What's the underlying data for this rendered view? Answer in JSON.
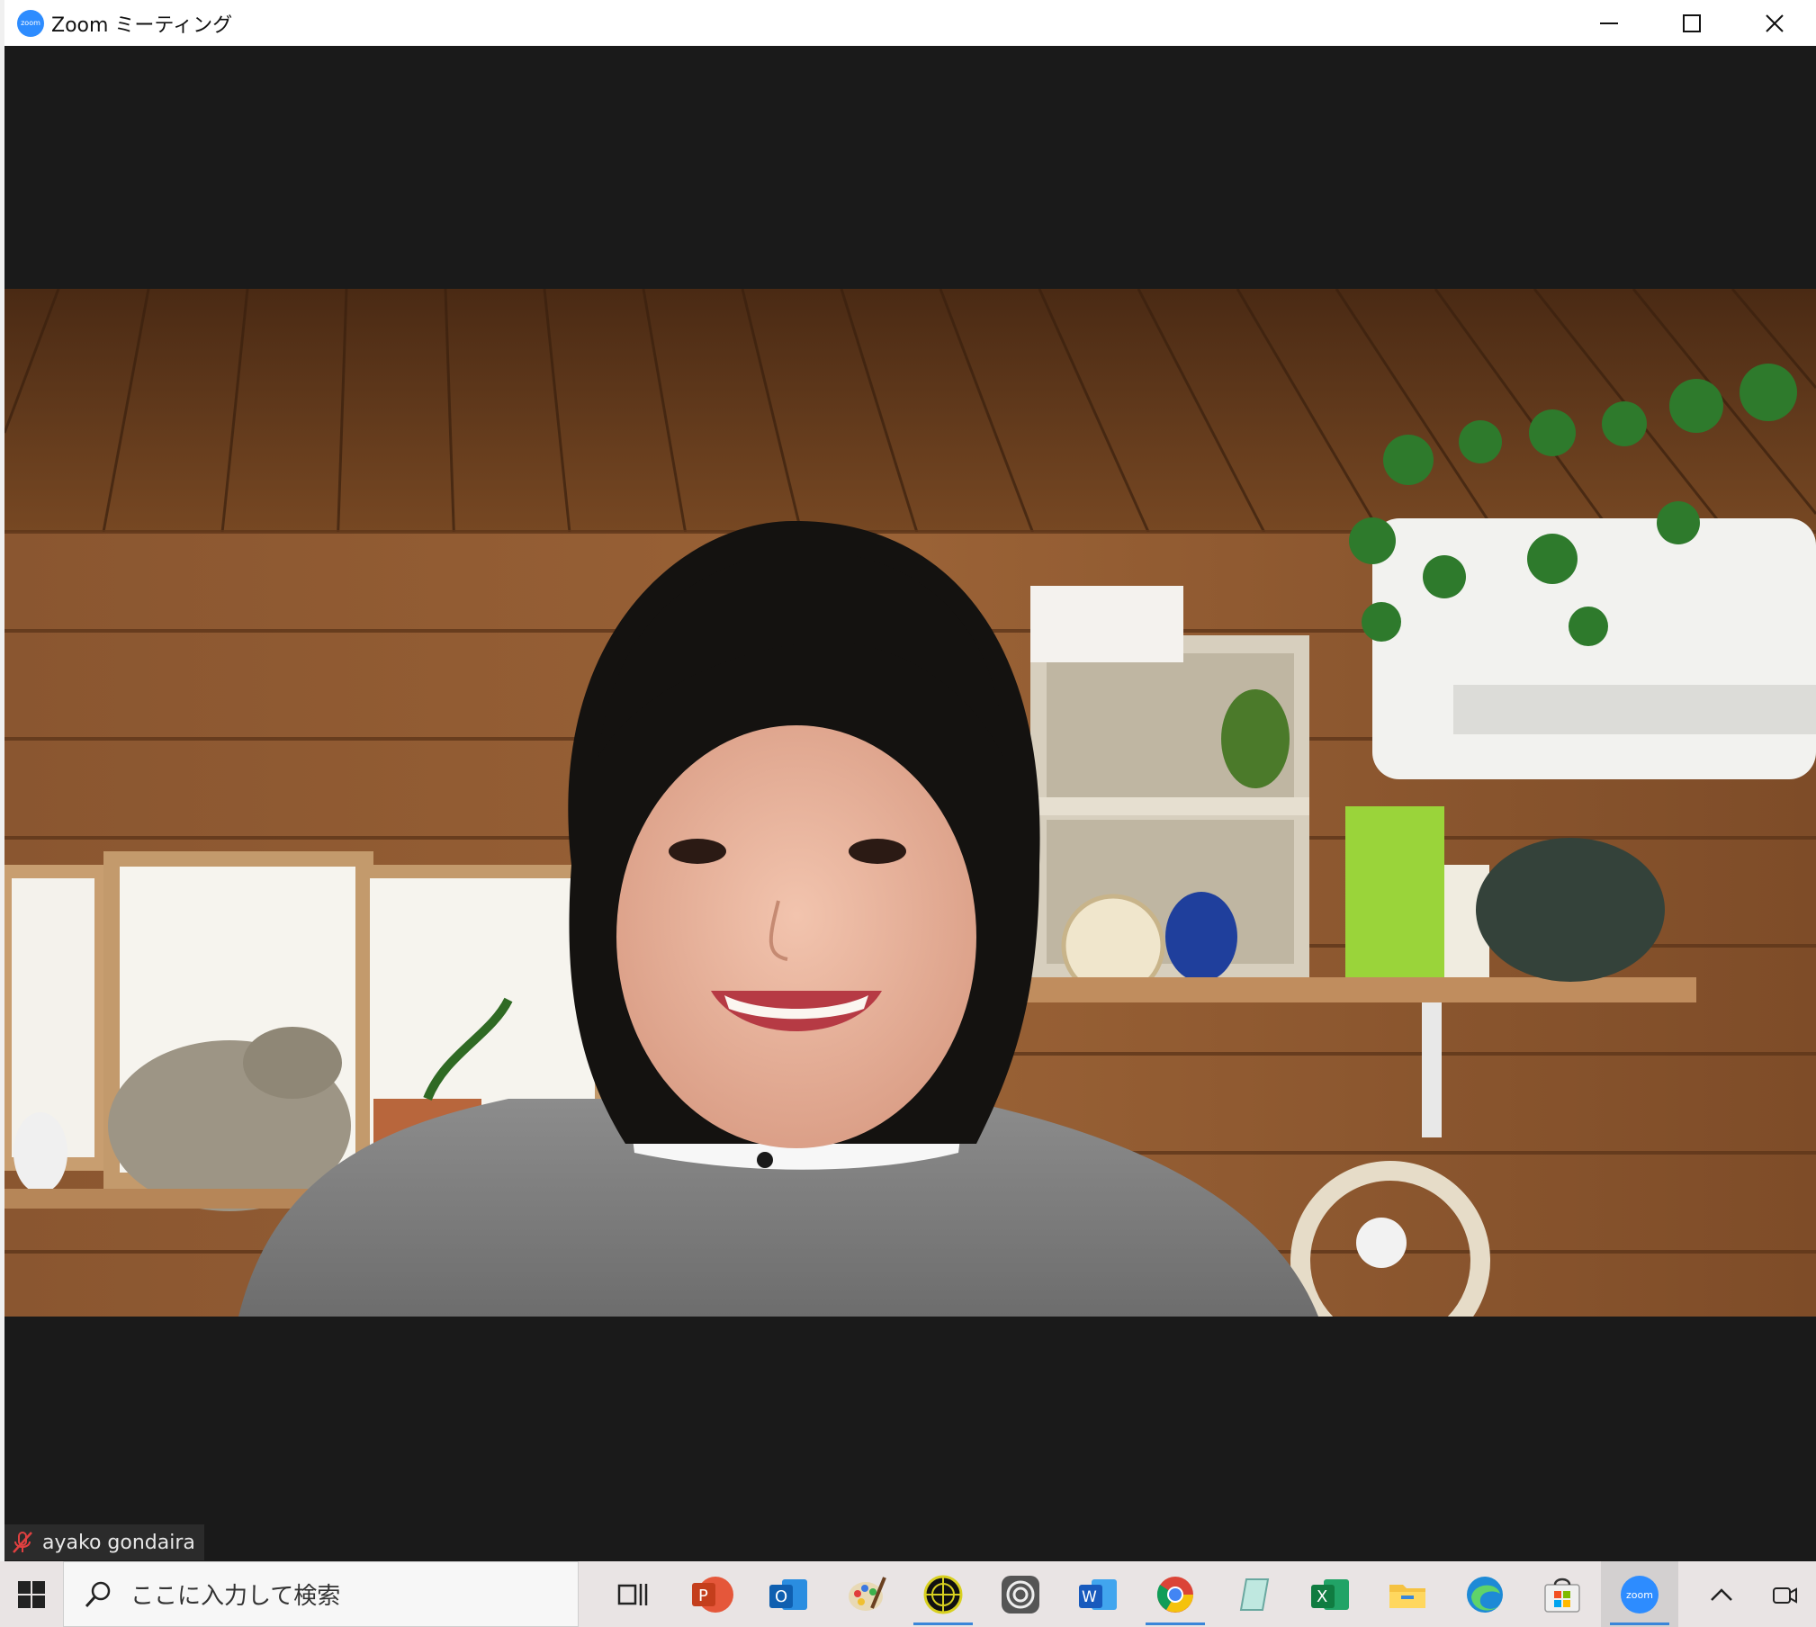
{
  "window": {
    "title": "Zoom ミーティング",
    "app_icon_text": "zoom"
  },
  "participant": {
    "name": "ayako gondaira",
    "muted": true
  },
  "taskbar": {
    "search_placeholder": "ここに入力して検索",
    "apps": [
      {
        "name": "task-view"
      },
      {
        "name": "powerpoint",
        "letter": "P"
      },
      {
        "name": "outlook",
        "letter": "O"
      },
      {
        "name": "paint"
      },
      {
        "name": "vpn-globe"
      },
      {
        "name": "creative-cloud"
      },
      {
        "name": "word",
        "letter": "W"
      },
      {
        "name": "chrome"
      },
      {
        "name": "notepad-app"
      },
      {
        "name": "excel",
        "letter": "X"
      },
      {
        "name": "file-explorer"
      },
      {
        "name": "edge"
      },
      {
        "name": "microsoft-store"
      },
      {
        "name": "zoom",
        "letter": "zoom"
      }
    ]
  },
  "colors": {
    "zoom_blue": "#2d8cff",
    "meeting_bg": "#1a1a1a",
    "taskbar_bg": "#e9e4e4"
  }
}
